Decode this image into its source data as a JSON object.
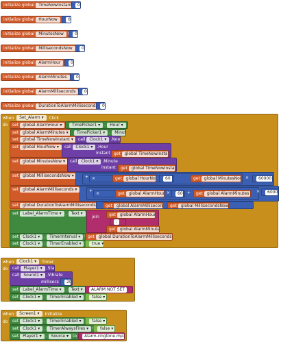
{
  "kw": {
    "initialize_global": "initialize global",
    "to": "to",
    "when": "when",
    "do": "do",
    "set": "set",
    "call": "call",
    "get": "get",
    "join": "join",
    "instant": "instant",
    "millisecs": "millisecs",
    "plus": "+",
    "times": "×",
    "minus": "-"
  },
  "globals": [
    {
      "name": "TimeNowInstant",
      "value": "0"
    },
    {
      "name": "HourNow",
      "value": "0"
    },
    {
      "name": "MinutesNow",
      "value": "0"
    },
    {
      "name": "MillisecondsNow",
      "value": "0"
    },
    {
      "name": "AlarmHour",
      "value": "0"
    },
    {
      "name": "AlarmMinutes",
      "value": "0"
    },
    {
      "name": "AlarmMilliseconds",
      "value": "0"
    },
    {
      "name": "DurationToAlarmMilliseconds",
      "value": "0"
    }
  ],
  "set_alarm": {
    "component": "Set_Alarm",
    "event": "Click",
    "rows": {
      "alarm_hour": {
        "var": "global AlarmHour",
        "comp": "TimePicker1",
        "prop": "Hour"
      },
      "alarm_minutes": {
        "var": "global AlarmMinutes",
        "comp": "TimePicker1",
        "prop": "Minute"
      },
      "time_now": {
        "var": "global TimeNowInstant",
        "comp": "Clock1",
        "method": "Now"
      },
      "hour_now": {
        "var": "global HourNow",
        "comp": "Clock1",
        "method": "Hour",
        "get": "global TimeNowInstant"
      },
      "minutes_now": {
        "var": "global MinutesNow",
        "comp": "Clock1",
        "method": "Minute",
        "get": "global TimeNowInstant"
      },
      "ms_now": {
        "var": "global MillisecondsNow",
        "get_hour": "global HourNow",
        "k60": "60",
        "get_min": "global MinutesNow",
        "k60000": "60000"
      },
      "alarm_ms": {
        "var": "global AlarmMilliseconds",
        "get_hour": "global AlarmHour",
        "k60": "60",
        "get_min": "global AlarmMinutes",
        "k60000": "60000"
      },
      "duration": {
        "var": "global DurationToAlarmMilliseconds",
        "get_a": "global AlarmMilliseconds",
        "get_b": "global MillisecondsNow"
      },
      "label": {
        "comp": "Label_AlarmTime",
        "prop": "Text",
        "get_hour": "global AlarmHour",
        "sep": " : ",
        "get_min": "global AlarmMinutes"
      },
      "interval": {
        "comp": "Clock1",
        "prop": "TimerInterval",
        "get": "global DurationToAlarmMilliseconds"
      },
      "enabled": {
        "comp": "Clock1",
        "prop": "TimerEnabled",
        "value": "true"
      }
    }
  },
  "clock_timer": {
    "component": "Clock1",
    "event": "Timer",
    "player": {
      "comp": "Player1",
      "method": "Start"
    },
    "sound": {
      "comp": "Sound1",
      "method": "Vibrate",
      "millisecs": "20"
    },
    "label": {
      "comp": "Label_AlarmTime",
      "prop": "Text",
      "value": " ALARM NOT SET "
    },
    "enabled": {
      "comp": "Clock1",
      "prop": "TimerEnabled",
      "value": "false"
    }
  },
  "screen_init": {
    "component": "Screen1",
    "event": "Initialize",
    "rows": [
      {
        "comp": "Clock1",
        "prop": "TimerEnabled",
        "value": "false"
      },
      {
        "comp": "Clock1",
        "prop": "TimerAlwaysFires",
        "value": "false"
      },
      {
        "comp": "Player1",
        "prop": "Source",
        "value": " Alarm-ringtone.mp3 "
      }
    ]
  },
  "colors": {
    "variable": "#d15a29",
    "event": "#c88f1c",
    "component": "#3f8a3e",
    "procedure": "#6e3fa6",
    "math": "#3b5fb3",
    "text": "#b12d6e"
  }
}
